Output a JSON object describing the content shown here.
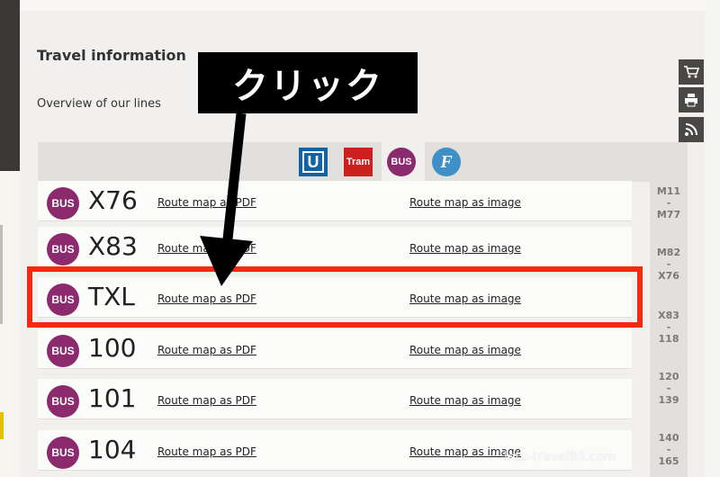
{
  "section": {
    "title": "Travel information",
    "overview": "Overview of our lines"
  },
  "tabs": {
    "u_label": "U",
    "tram_label": "Tram",
    "bus_label": "BUS",
    "ferry_label": "F",
    "active": "BUS"
  },
  "rows": [
    {
      "badge": "BUS",
      "line": "X76",
      "pdf": "Route map as PDF",
      "image": "Route map as image"
    },
    {
      "badge": "BUS",
      "line": "X83",
      "pdf": "Route map as PDF",
      "image": "Route map as image"
    },
    {
      "badge": "BUS",
      "line": "TXL",
      "pdf": "Route map as PDF",
      "image": "Route map as image"
    },
    {
      "badge": "BUS",
      "line": "100",
      "pdf": "Route map as PDF",
      "image": "Route map as image"
    },
    {
      "badge": "BUS",
      "line": "101",
      "pdf": "Route map as PDF",
      "image": "Route map as image"
    },
    {
      "badge": "BUS",
      "line": "104",
      "pdf": "Route map as PDF",
      "image": "Route map as image"
    }
  ],
  "ranges": [
    {
      "text": "M11\n-\nM77"
    },
    {
      "text": "M82\n-\nX76"
    },
    {
      "text": "X83\n-\n118"
    },
    {
      "text": "120\n-\n139"
    },
    {
      "text": "140\n-\n165"
    }
  ],
  "floating_icons": [
    "cart-icon",
    "print-icon",
    "rss-icon"
  ],
  "annotation": {
    "label": "クリック",
    "highlight_color": "#f5290e"
  },
  "watermark": "letu-travel83.com",
  "colors": {
    "bus": "#8b2a6d",
    "ubahn": "#1262a6",
    "tram": "#cc1f1f",
    "ferry": "#3f8fc8"
  }
}
